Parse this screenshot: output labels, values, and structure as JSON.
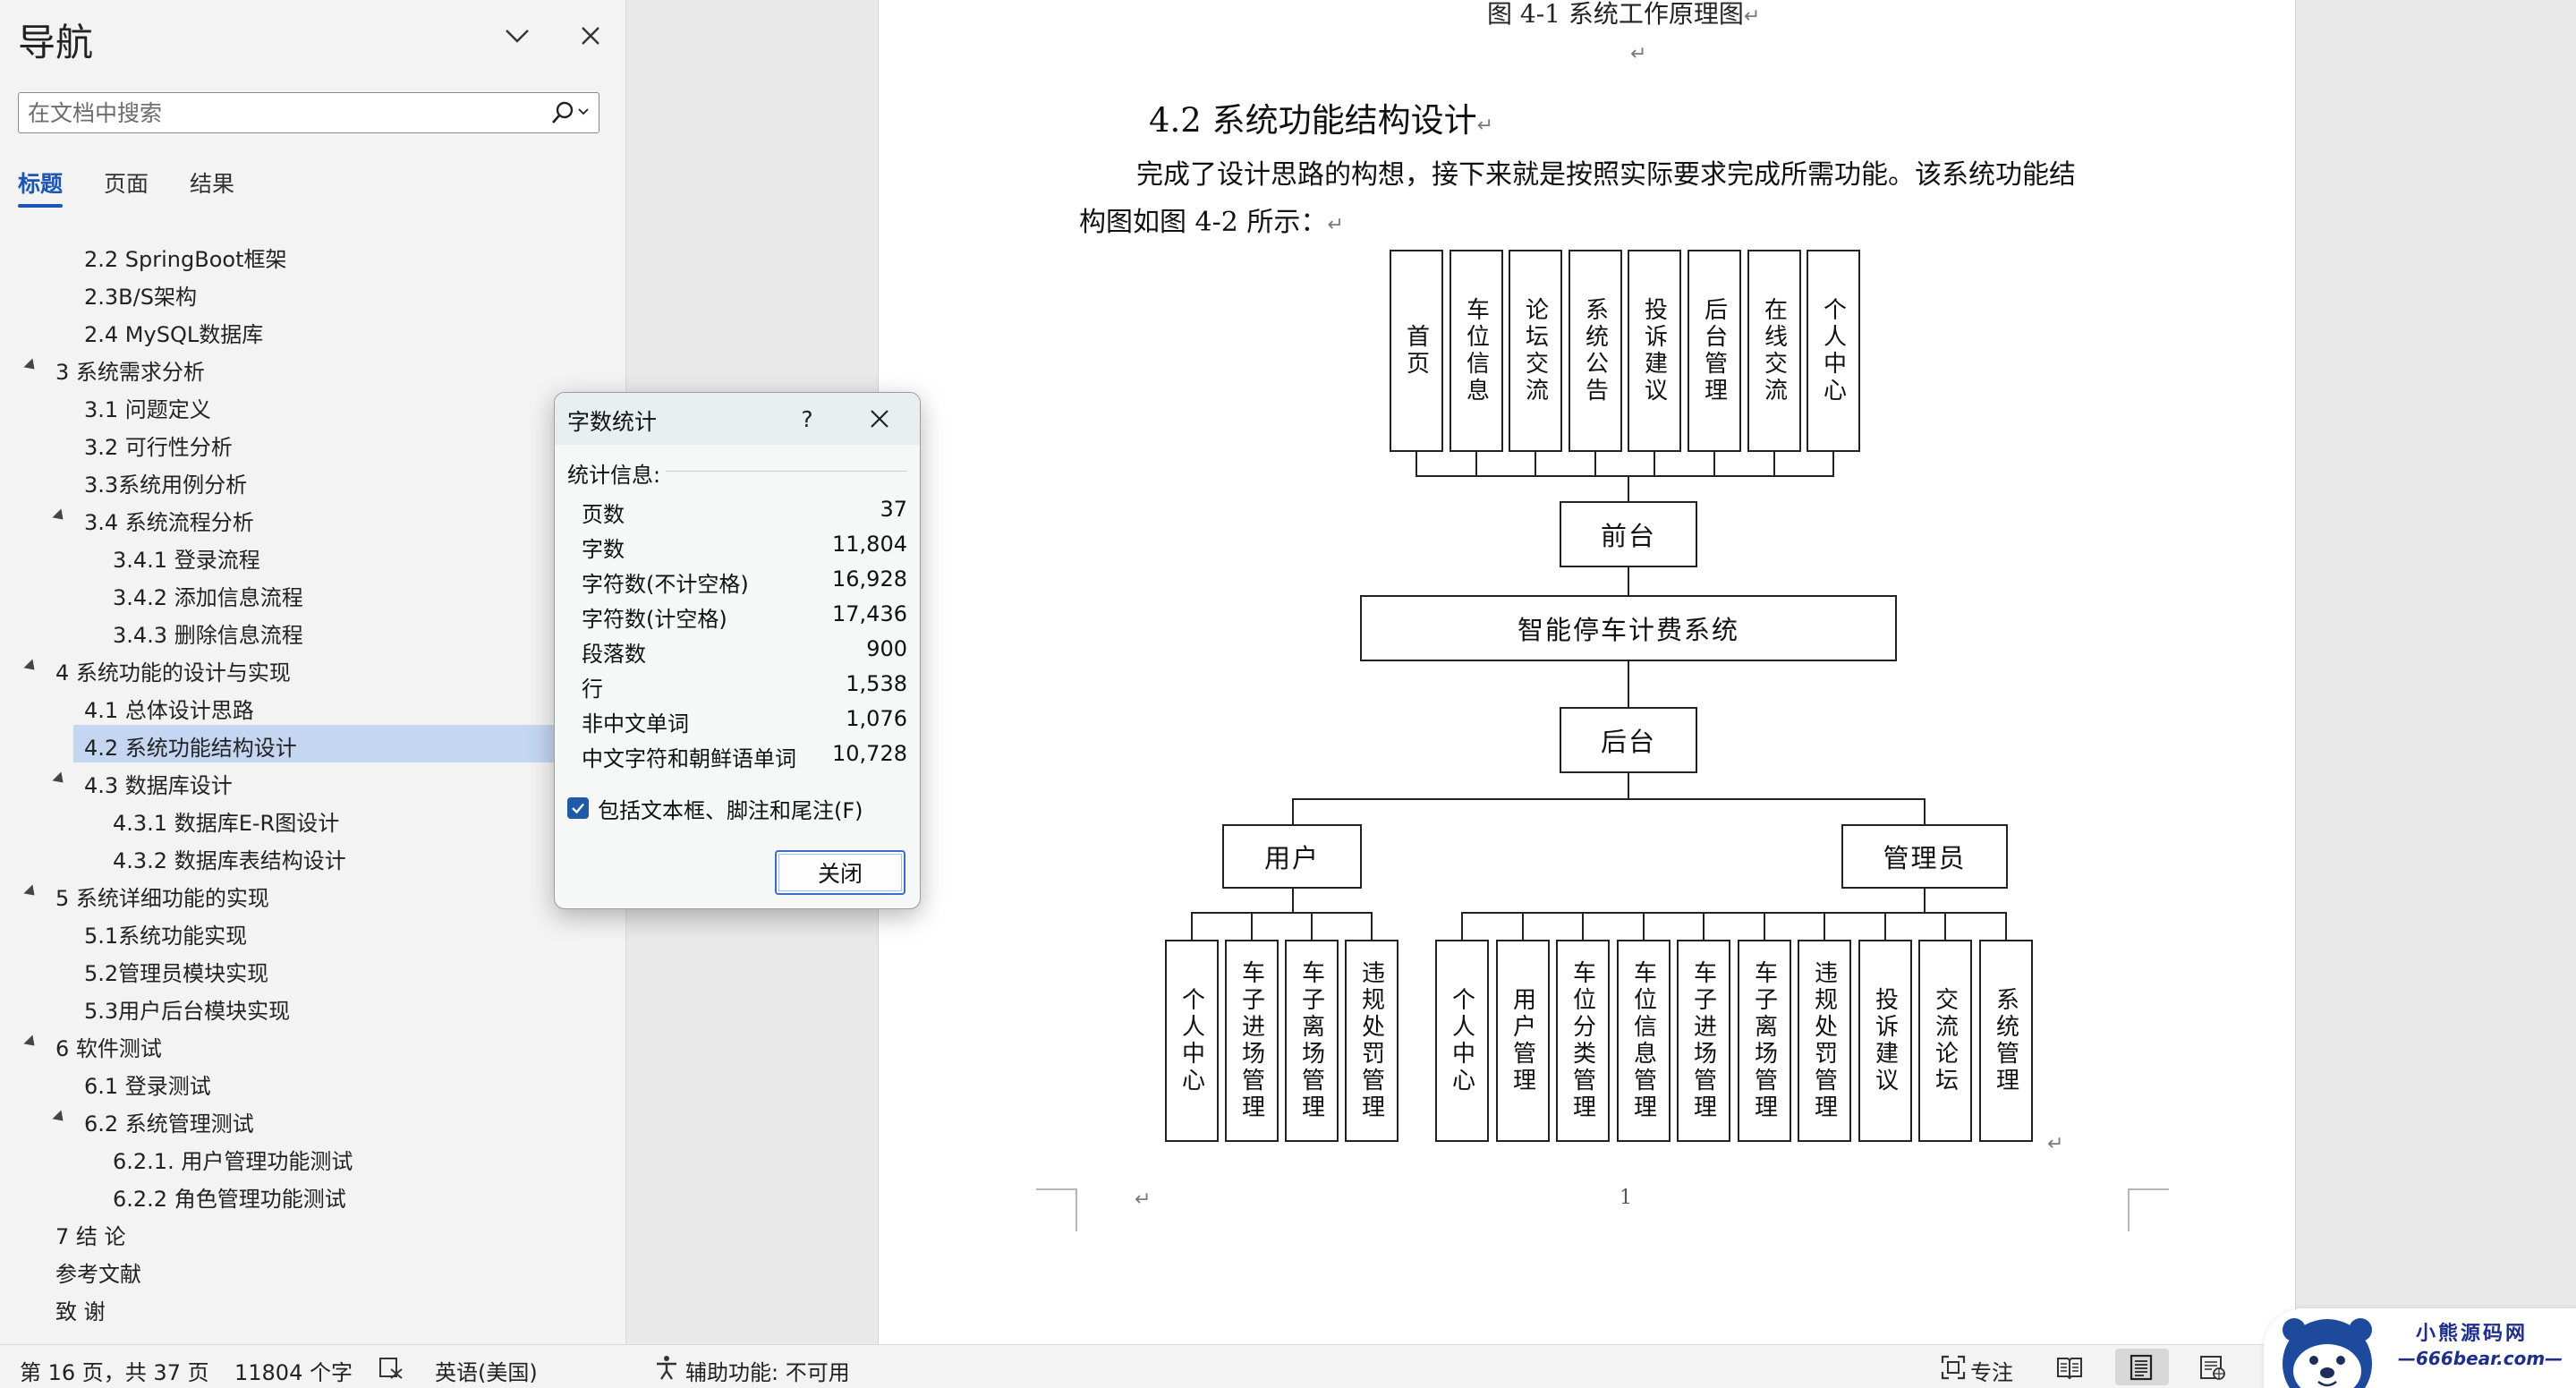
{
  "nav": {
    "title": "导航",
    "search_placeholder": "在文档中搜索",
    "tabs": [
      "标题",
      "页面",
      "结果"
    ],
    "headings": [
      {
        "text": "2.2 SpringBoot框架",
        "level": 2,
        "caret": false,
        "selected": false
      },
      {
        "text": "2.3B/S架构",
        "level": 2,
        "caret": false,
        "selected": false
      },
      {
        "text": "2.4 MySQL数据库",
        "level": 2,
        "caret": false,
        "selected": false
      },
      {
        "text": "3 系统需求分析",
        "level": 1,
        "caret": true,
        "selected": false
      },
      {
        "text": "3.1 问题定义",
        "level": 2,
        "caret": false,
        "selected": false
      },
      {
        "text": "3.2 可行性分析",
        "level": 2,
        "caret": false,
        "selected": false
      },
      {
        "text": "3.3系统用例分析",
        "level": 2,
        "caret": false,
        "selected": false
      },
      {
        "text": "3.4 系统流程分析",
        "level": 2,
        "caret": true,
        "selected": false
      },
      {
        "text": "3.4.1 登录流程",
        "level": 3,
        "caret": false,
        "selected": false
      },
      {
        "text": "3.4.2 添加信息流程",
        "level": 3,
        "caret": false,
        "selected": false
      },
      {
        "text": "3.4.3 删除信息流程",
        "level": 3,
        "caret": false,
        "selected": false
      },
      {
        "text": "4 系统功能的设计与实现",
        "level": 1,
        "caret": true,
        "selected": false
      },
      {
        "text": "4.1 总体设计思路",
        "level": 2,
        "caret": false,
        "selected": false
      },
      {
        "text": "4.2 系统功能结构设计",
        "level": 2,
        "caret": false,
        "selected": true
      },
      {
        "text": "4.3 数据库设计",
        "level": 2,
        "caret": true,
        "selected": false
      },
      {
        "text": "4.3.1 数据库E-R图设计",
        "level": 3,
        "caret": false,
        "selected": false
      },
      {
        "text": "4.3.2 数据库表结构设计",
        "level": 3,
        "caret": false,
        "selected": false
      },
      {
        "text": "5 系统详细功能的实现",
        "level": 1,
        "caret": true,
        "selected": false
      },
      {
        "text": "5.1系统功能实现",
        "level": 2,
        "caret": false,
        "selected": false
      },
      {
        "text": "5.2管理员模块实现",
        "level": 2,
        "caret": false,
        "selected": false
      },
      {
        "text": "5.3用户后台模块实现",
        "level": 2,
        "caret": false,
        "selected": false
      },
      {
        "text": "6 软件测试",
        "level": 1,
        "caret": true,
        "selected": false
      },
      {
        "text": "6.1 登录测试",
        "level": 2,
        "caret": false,
        "selected": false
      },
      {
        "text": "6.2 系统管理测试",
        "level": 2,
        "caret": true,
        "selected": false
      },
      {
        "text": "6.2.1. 用户管理功能测试",
        "level": 3,
        "caret": false,
        "selected": false
      },
      {
        "text": "6.2.2 角色管理功能测试",
        "level": 3,
        "caret": false,
        "selected": false
      },
      {
        "text": "7 结  论",
        "level": 1,
        "caret": false,
        "selected": false
      },
      {
        "text": "参考文献",
        "level": 1,
        "caret": false,
        "selected": false
      },
      {
        "text": "致  谢",
        "level": 1,
        "caret": false,
        "selected": false
      }
    ]
  },
  "doc": {
    "fig_caption_prev": "图 4-1  系统工作原理图",
    "heading": "4.2  系统功能结构设计",
    "para_line1": "完成了设计思路的构想，接下来就是按照实际要求完成所需功能。该系统功能结",
    "para_line2": "构图如图 4-2 所示：",
    "page_number": "1",
    "para_mark": "↵",
    "diagram": {
      "front_items": [
        "首页",
        "车位信息",
        "论坛交流",
        "系统公告",
        "投诉建议",
        "后台管理",
        "在线交流",
        "个人中心"
      ],
      "front": "前台",
      "system": "智能停车计费系统",
      "back": "后台",
      "user": "用户",
      "admin": "管理员",
      "user_items": [
        "个人中心",
        "车子进场管理",
        "车子离场管理",
        "违规处罚管理"
      ],
      "admin_items": [
        "个人中心",
        "用户管理",
        "车位分类管理",
        "车位信息管理",
        "车子进场管理",
        "车子离场管理",
        "违规处罚管理",
        "投诉建议",
        "交流论坛",
        "系统管理"
      ]
    }
  },
  "dialog": {
    "title": "字数统计",
    "help": "?",
    "section": "统计信息:",
    "stats": [
      {
        "label": "页数",
        "value": "37"
      },
      {
        "label": "字数",
        "value": "11,804"
      },
      {
        "label": "字符数(不计空格)",
        "value": "16,928"
      },
      {
        "label": "字符数(计空格)",
        "value": "17,436"
      },
      {
        "label": "段落数",
        "value": "900"
      },
      {
        "label": "行",
        "value": "1,538"
      },
      {
        "label": "非中文单词",
        "value": "1,076"
      },
      {
        "label": "中文字符和朝鲜语单词",
        "value": "10,728"
      }
    ],
    "include_label": "包括文本框、脚注和尾注(F)",
    "include_checked": true,
    "close_label": "关闭"
  },
  "status": {
    "page": "第 16 页，共 37 页",
    "words": "11804 个字",
    "language": "英语(美国)",
    "accessibility": "辅助功能: 不可用",
    "focus": "专注"
  },
  "watermark": {
    "line1": "小熊源码网",
    "line2": "—666bear.com—"
  },
  "colors": {
    "accent": "#1c55b5",
    "selection": "#c5d6f2",
    "checkbox": "#1f5aa6"
  }
}
